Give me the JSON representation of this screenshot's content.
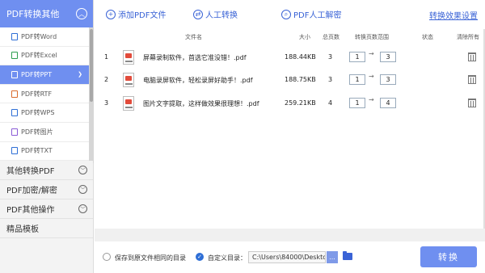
{
  "sidebar": {
    "header": "PDF转换其他",
    "sub_items": [
      {
        "label": "PDF转Word",
        "color": "#2f6fd6"
      },
      {
        "label": "PDF转Excel",
        "color": "#2e9e4f"
      },
      {
        "label": "PDF转PPT",
        "color": "#ffffff"
      },
      {
        "label": "PDF转RTF",
        "color": "#d96a2b"
      },
      {
        "label": "PDF转WPS",
        "color": "#2f6fd6"
      },
      {
        "label": "PDF转图片",
        "color": "#8a5bd6"
      },
      {
        "label": "PDF转TXT",
        "color": "#2f6fd6"
      }
    ],
    "categories": [
      "其他转换PDF",
      "PDF加密/解密",
      "PDF其他操作",
      "精品模板"
    ]
  },
  "toolbar": {
    "add_pdf": "添加PDF文件",
    "manual_convert": "人工转换",
    "manual_decrypt": "PDF人工解密",
    "result_settings": "转换效果设置"
  },
  "table": {
    "headers": {
      "filename": "文件名",
      "size": "大小",
      "pages": "总页数",
      "range": "转换页数范围",
      "status": "状态",
      "clear_all": "清除所有"
    },
    "rows": [
      {
        "index": "1",
        "name": "屏幕录制软件，首选它准没错！.pdf",
        "size": "188.44KB",
        "pages": "3",
        "from": "1",
        "to": "3"
      },
      {
        "index": "2",
        "name": "电脑录屏软件，轻松录屏好助手！.pdf",
        "size": "188.75KB",
        "pages": "3",
        "from": "1",
        "to": "3"
      },
      {
        "index": "3",
        "name": "图片文字提取，这样做效果很理想！.pdf",
        "size": "259.21KB",
        "pages": "4",
        "from": "1",
        "to": "4"
      }
    ],
    "range_separator": "→"
  },
  "bottom": {
    "save_same_dir": "保存到原文件相同的目录",
    "custom_dir": "自定义目录：",
    "path": "C:\\Users\\84000\\Desktop\\",
    "browse": "...",
    "convert": "转换"
  },
  "colors": {
    "accent": "#6f8ff0",
    "link": "#3a63d6"
  }
}
